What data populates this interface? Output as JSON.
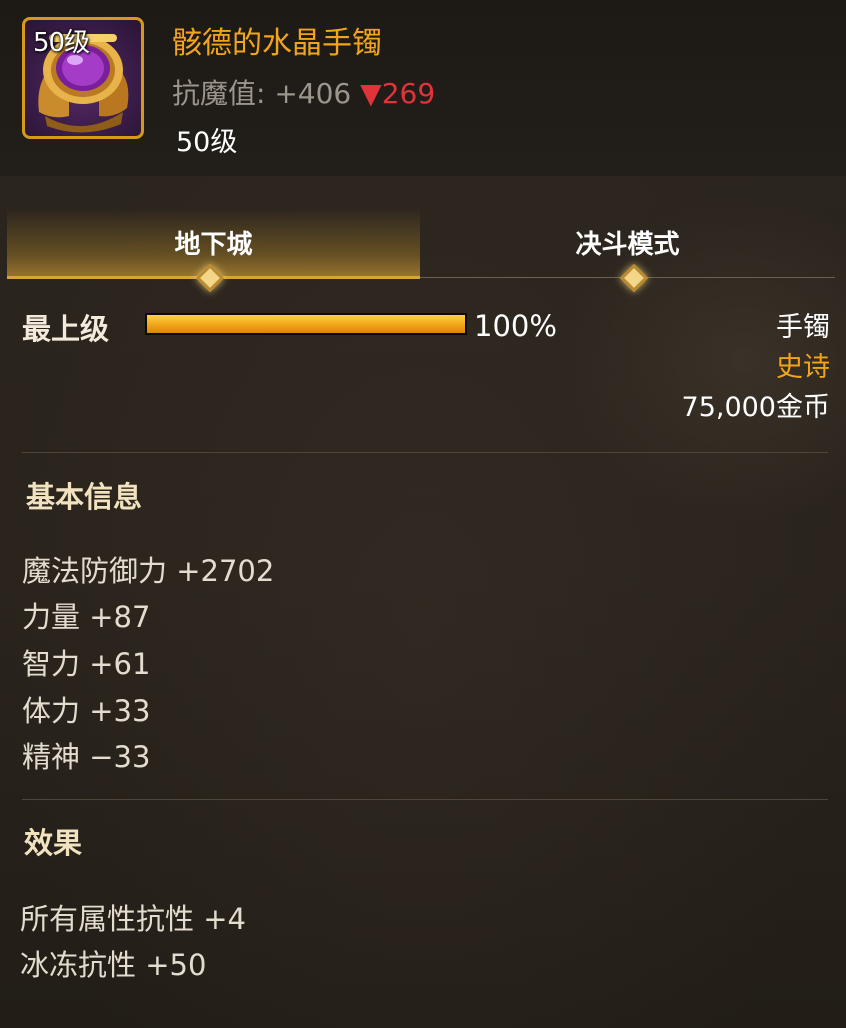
{
  "item": {
    "name": "骸德的水晶手镯",
    "icon": "crystal-bracelet-icon",
    "level_badge": "50级",
    "magic_resist_label": "抗魔值:",
    "magic_resist_value": "+406",
    "magic_resist_drop_arrow": "▼",
    "magic_resist_drop": "269",
    "required_level": "50级"
  },
  "tabs": [
    {
      "label": "地下城",
      "active": true
    },
    {
      "label": "决斗模式",
      "active": false
    }
  ],
  "grade": {
    "label": "最上级",
    "percent_text": "100%",
    "fill_fraction": 1.0
  },
  "meta": {
    "type": "手镯",
    "rarity": "史诗",
    "price": "75,000金币"
  },
  "sections": {
    "basic_info_title": "基本信息",
    "effects_title": "效果"
  },
  "stats": [
    "魔法防御力 +2702",
    "力量 +87",
    "智力 +61",
    "体力 +33",
    "精神 −33"
  ],
  "effects": [
    "所有属性抗性 +4",
    "冰冻抗性 +50"
  ],
  "colors": {
    "accent_gold": "#f2a51a",
    "drop_red": "#e0333a",
    "panel_bg": "#2a241d"
  }
}
